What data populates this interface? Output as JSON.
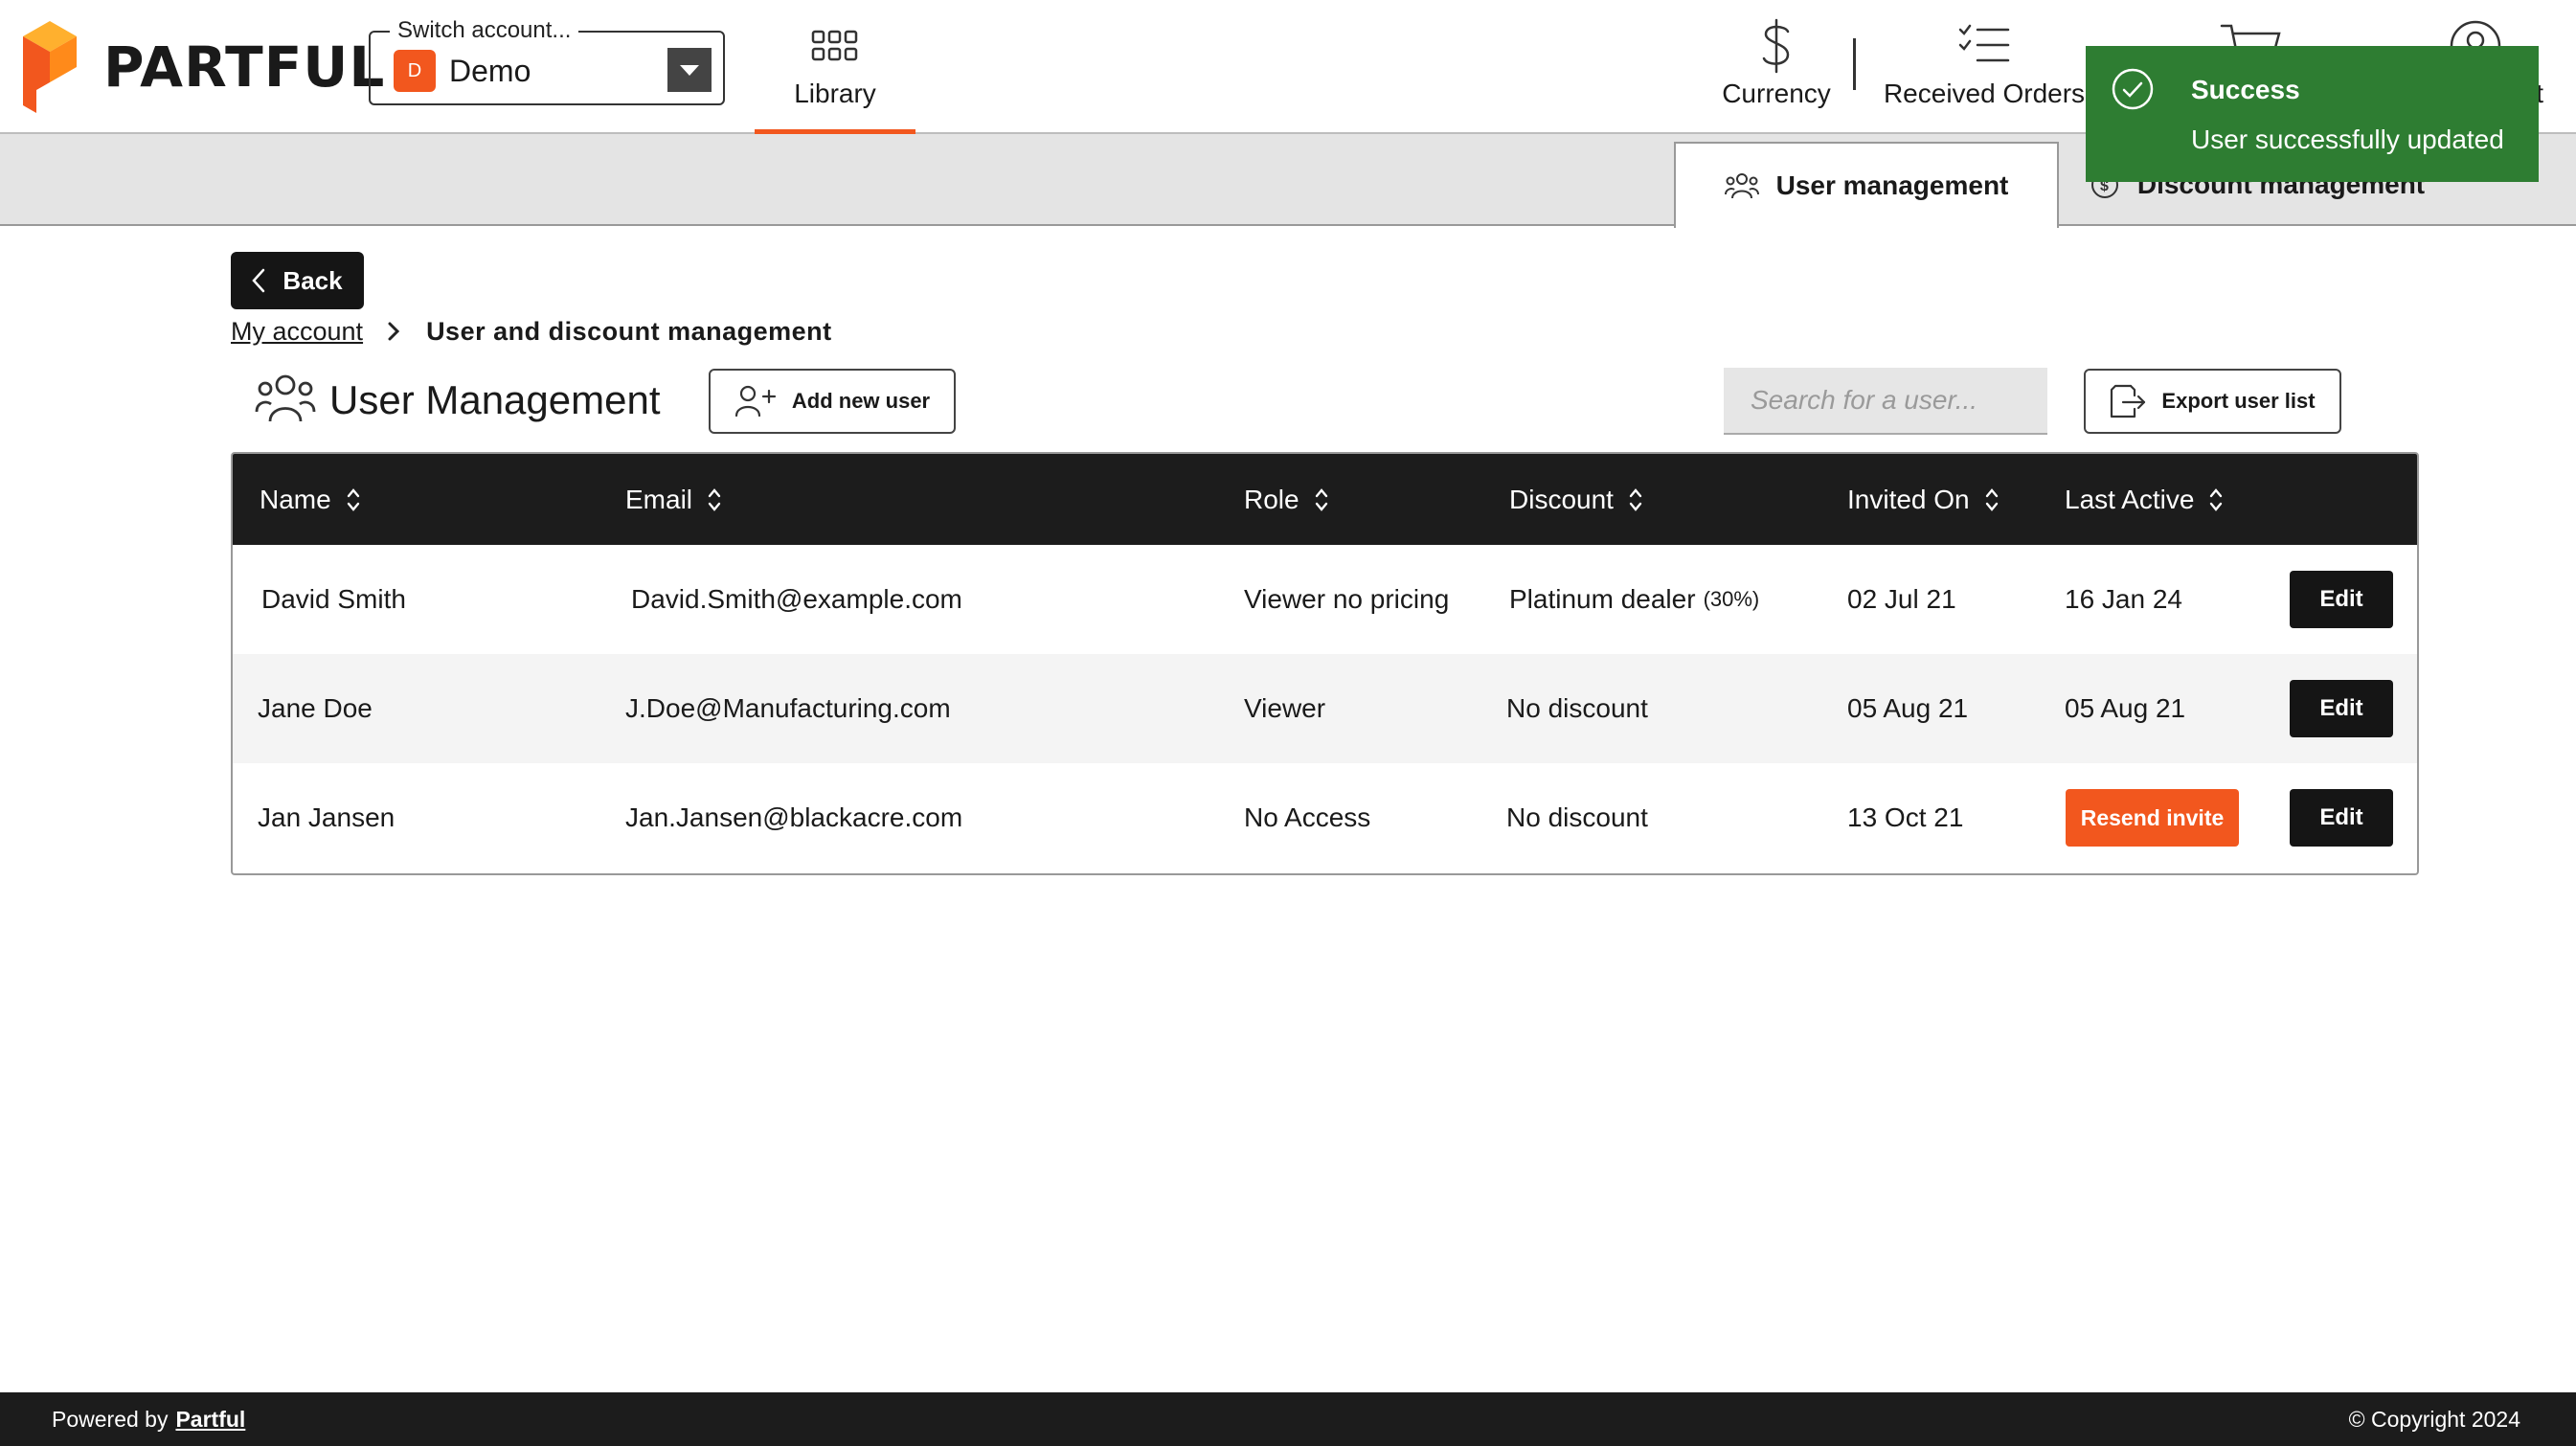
{
  "brand": {
    "name": "PARTFUL",
    "accent": "#f2571e"
  },
  "account_switcher": {
    "legend": "Switch account...",
    "badge": "D",
    "name": "Demo"
  },
  "nav": {
    "library": "Library",
    "currency": "Currency",
    "received_orders": "Received Orders",
    "account_label_fragment": "t"
  },
  "tabs": {
    "user_management": "User management",
    "discount_management": "Discount management"
  },
  "toast": {
    "title": "Success",
    "message": "User successfully updated",
    "color": "#2e7d32"
  },
  "back_label": "Back",
  "breadcrumb": {
    "parent": "My account",
    "current": "User and discount management"
  },
  "page_title": "User Management",
  "actions": {
    "add_user": "Add new user",
    "export": "Export user list"
  },
  "search": {
    "placeholder": "Search for a user..."
  },
  "table": {
    "columns": [
      "Name",
      "Email",
      "Role",
      "Discount",
      "Invited On",
      "Last Active"
    ],
    "rows": [
      {
        "name": "David Smith",
        "email": "David.Smith@example.com",
        "role": "Viewer no pricing",
        "discount": "Platinum dealer",
        "discount_note": "(30%)",
        "invited": "02 Jul 21",
        "last_active": "16 Jan 24",
        "edit": "Edit"
      },
      {
        "name": "Jane Doe",
        "email": "J.Doe@Manufacturing.com",
        "role": "Viewer",
        "discount": "No discount",
        "invited": "05 Aug 21",
        "last_active": "05 Aug 21",
        "edit": "Edit"
      },
      {
        "name": "Jan Jansen",
        "email": "Jan.Jansen@blackacre.com",
        "role": "No Access",
        "discount": "No discount",
        "invited": "13 Oct 21",
        "resend": "Resend invite",
        "edit": "Edit"
      }
    ]
  },
  "footer": {
    "powered_by": "Powered by",
    "brand": "Partful",
    "copyright": "© Copyright 2024"
  }
}
